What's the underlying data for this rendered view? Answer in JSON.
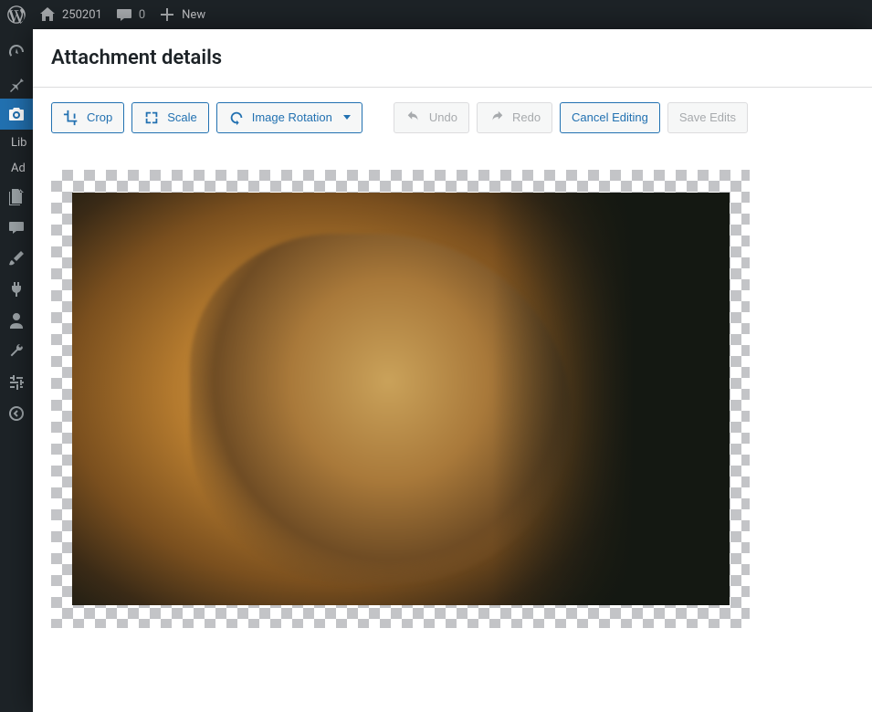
{
  "adminbar": {
    "site_title": "250201",
    "comments_count": "0",
    "new_label": "New"
  },
  "sidebar": {
    "items": [
      {
        "id": "dashboard",
        "icon": "gauge"
      },
      {
        "id": "posts",
        "icon": "pin"
      },
      {
        "id": "media",
        "icon": "camera",
        "active": true
      },
      {
        "id": "pages",
        "icon": "pages"
      },
      {
        "id": "comments",
        "icon": "comment"
      },
      {
        "id": "appearance",
        "icon": "brush"
      },
      {
        "id": "plugins",
        "icon": "plug"
      },
      {
        "id": "users",
        "icon": "user"
      },
      {
        "id": "tools",
        "icon": "wrench"
      },
      {
        "id": "settings",
        "icon": "sliders"
      },
      {
        "id": "collapse",
        "icon": "collapse"
      }
    ],
    "submenu": {
      "library_label": "Lib",
      "add_label": "Ad"
    }
  },
  "modal": {
    "title": "Attachment details",
    "toolbar": {
      "crop_label": "Crop",
      "scale_label": "Scale",
      "rotation_label": "Image Rotation",
      "undo_label": "Undo",
      "redo_label": "Redo",
      "cancel_label": "Cancel Editing",
      "save_label": "Save Edits"
    },
    "image": {
      "subject": "lion",
      "alt_description": "Close-up photo of a lion's head in profile against a dark background"
    }
  }
}
